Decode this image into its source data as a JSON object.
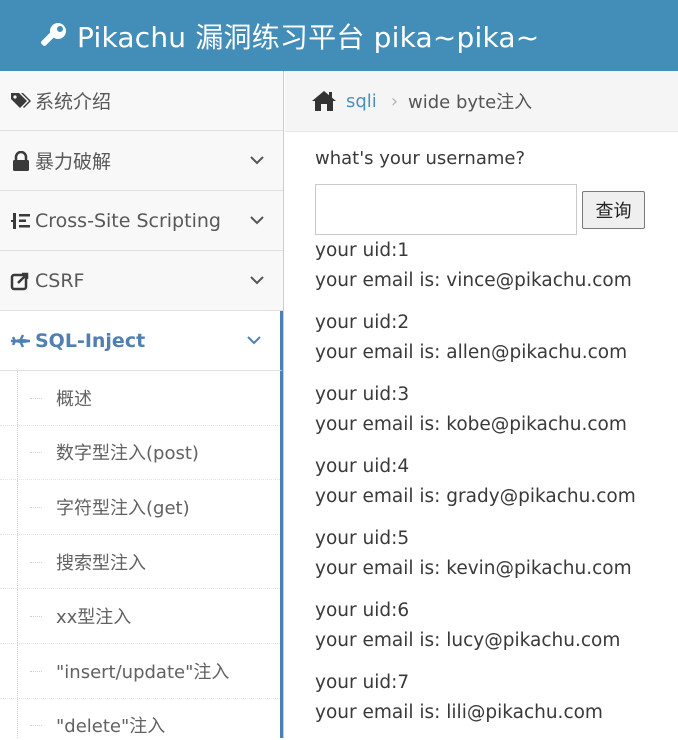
{
  "header": {
    "brand": "Pikachu 漏洞练习平台 pika~pika~",
    "icon": "wrench-icon"
  },
  "sidebar": {
    "items": [
      {
        "label": "系统介绍",
        "icon": "tags-icon"
      },
      {
        "label": "暴力破解",
        "icon": "lock-icon"
      },
      {
        "label": "Cross-Site Scripting",
        "icon": "list-indent-icon"
      },
      {
        "label": "CSRF",
        "icon": "share-icon"
      },
      {
        "label": "SQL-Inject",
        "icon": "plane-icon"
      }
    ],
    "submenu": [
      "概述",
      "数字型注入(post)",
      "字符型注入(get)",
      "搜索型注入",
      "xx型注入",
      "\"insert/update\"注入",
      "\"delete\"注入"
    ]
  },
  "breadcrumb": {
    "link": "sqli",
    "current": "wide byte注入"
  },
  "form": {
    "prompt": "what's your username?",
    "input_value": "",
    "button": "查询"
  },
  "results": [
    {
      "uid": "your uid:1",
      "email": "your email is: vince@pikachu.com"
    },
    {
      "uid": "your uid:2",
      "email": "your email is: allen@pikachu.com"
    },
    {
      "uid": "your uid:3",
      "email": "your email is: kobe@pikachu.com"
    },
    {
      "uid": "your uid:4",
      "email": "your email is: grady@pikachu.com"
    },
    {
      "uid": "your uid:5",
      "email": "your email is: kevin@pikachu.com"
    },
    {
      "uid": "your uid:6",
      "email": "your email is: lucy@pikachu.com"
    },
    {
      "uid": "your uid:7",
      "email": "your email is: lili@pikachu.com"
    }
  ],
  "colors": {
    "header_bg": "#438eb9",
    "accent": "#4f80b1",
    "link": "#4c8fbd"
  }
}
